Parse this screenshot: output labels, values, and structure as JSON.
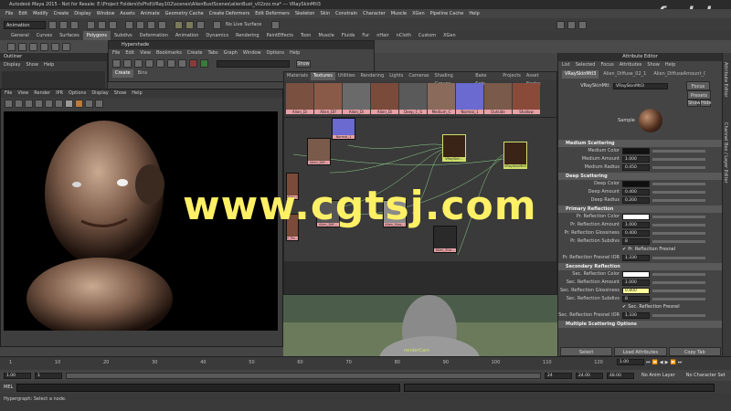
{
  "window": {
    "title": "Autodesk Maya 2015 - Not for Resale: E:\\Project Folders\\fxPhd\\VRay102\\scenes\\AlienBustScenes\\alienBust_v02zzz.ma* --- VRaySkinMtl3"
  },
  "menubar": [
    "File",
    "Edit",
    "Modify",
    "Create",
    "Display",
    "Window",
    "Assets",
    "Animate",
    "Geometry Cache",
    "Create Deformers",
    "Edit Deformers",
    "Skeleton",
    "Skin",
    "Constrain",
    "Character",
    "Muscle",
    "XGen",
    "Pipeline Cache",
    "Help"
  ],
  "statusline": {
    "mode": "Animation",
    "live_surface": "No Live Surface"
  },
  "shelf_tabs": [
    "General",
    "Curves",
    "Surfaces",
    "Polygons",
    "Subdivs",
    "Deformation",
    "Animation",
    "Dynamics",
    "Rendering",
    "PaintEffects",
    "Toon",
    "Muscle",
    "Fluids",
    "Fur",
    "nHair",
    "nCloth",
    "Custom",
    "XGen"
  ],
  "shelf_active": "Polygons",
  "outliner": {
    "title": "Outliner",
    "menu": [
      "Display",
      "Show",
      "Help"
    ]
  },
  "hypershade": {
    "title": "Hypershade",
    "menu": [
      "File",
      "Edit",
      "View",
      "Bookmarks",
      "Create",
      "Tabs",
      "Graph",
      "Window",
      "Options",
      "Help"
    ],
    "left_tabs": [
      "Create",
      "Bins"
    ],
    "show_button": "Show",
    "tabs": [
      "Materials",
      "Textures",
      "Utilities",
      "Rendering",
      "Lights",
      "Cameras",
      "Shading Groups",
      "Bake Sets",
      "Projects",
      "Asset Nodes"
    ],
    "active_tab": "Textures",
    "swatches": [
      "Alien_Di",
      "Alien_Dif",
      "Alien_Di",
      "Alien_Di",
      "Deep_C_S",
      "Medium_C",
      "Normal_1",
      "Outside",
      "Shallow"
    ],
    "nodes": [
      "Normal_1",
      "Alien_Diff...",
      "VRaySkin...",
      "Alien_Diff...",
      "Alien_Glos...",
      "Alien_Glos...",
      "VRaySkinMtl3",
      "C_Ro...",
      "Alien_Sha..."
    ],
    "camera_label": "renderCam"
  },
  "render_view": {
    "menu": [
      "File",
      "View",
      "Render",
      "IPR",
      "Options",
      "Display",
      "Show",
      "Help"
    ]
  },
  "attribute_editor": {
    "title": "Attribute Editor",
    "menu": [
      "List",
      "Selected",
      "Focus",
      "Attributes",
      "Show",
      "Help"
    ],
    "tabs": [
      "VRaySkinMtl3",
      "Alien_Diffuse_02_1",
      "Alien_DiffuseAmount_03_1"
    ],
    "node_label": "VRaySkinMtl:",
    "node_name": "VRaySkinMtl3",
    "buttons": {
      "focus": "Focus",
      "presets": "Presets",
      "show": "Show",
      "hide": "Hide"
    },
    "sample_label": "Sample",
    "sections": [
      {
        "name": "Medium Scattering",
        "rows": [
          {
            "label": "Medium Color",
            "type": "color",
            "color": "#111111"
          },
          {
            "label": "Medium Amount",
            "type": "value",
            "value": "1.000"
          },
          {
            "label": "Medium Radius",
            "type": "value",
            "value": "0.450"
          }
        ]
      },
      {
        "name": "Deep Scattering",
        "rows": [
          {
            "label": "Deep Color",
            "type": "color",
            "color": "#0f0f0f"
          },
          {
            "label": "Deep Amount",
            "type": "value",
            "value": "0.400"
          },
          {
            "label": "Deep Radius",
            "type": "value",
            "value": "0.200"
          }
        ]
      },
      {
        "name": "Primary Reflection",
        "rows": [
          {
            "label": "Pr. Reflection Color",
            "type": "color",
            "color": "#ffffff"
          },
          {
            "label": "Pr. Reflection Amount",
            "type": "value",
            "value": "1.000"
          },
          {
            "label": "Pr. Reflection Glossiness",
            "type": "value",
            "value": "0.400"
          },
          {
            "label": "Pr. Reflection Subdivs",
            "type": "value",
            "value": "8"
          },
          {
            "label": "",
            "type": "check",
            "value": "Pr. Reflection Fresnel"
          },
          {
            "label": "Pr. Reflection Fresnel IOR",
            "type": "value",
            "value": "1.330"
          }
        ]
      },
      {
        "name": "Secondary Reflection",
        "rows": [
          {
            "label": "Sec. Reflection Color",
            "type": "color",
            "color": "#ffffff"
          },
          {
            "label": "Sec. Reflection Amount",
            "type": "value",
            "value": "1.000"
          },
          {
            "label": "Sec. Reflection Glossiness",
            "type": "value",
            "value": "0.800",
            "highlight": "#ffff99"
          },
          {
            "label": "Sec. Reflection Subdivs",
            "type": "value",
            "value": "8"
          },
          {
            "label": "",
            "type": "check",
            "value": "Sec. Reflection Fresnel"
          },
          {
            "label": "Sec. Reflection Fresnel IOR",
            "type": "value",
            "value": "1.330"
          }
        ]
      },
      {
        "name": "Multiple Scattering Options",
        "rows": []
      }
    ],
    "bottom_buttons": [
      "Select",
      "Load Attributes",
      "Copy Tab"
    ],
    "side_tabs": [
      "Attribute Editor",
      "Channel Box / Layer Editor"
    ]
  },
  "timeline": {
    "ticks": [
      "1",
      "10",
      "20",
      "30",
      "40",
      "50",
      "60",
      "70",
      "80",
      "90",
      "100",
      "110",
      "120"
    ],
    "current_frame": "1.00",
    "range_start": "1.00",
    "range_inner_start": "1",
    "range_inner_end": "24",
    "range_end": "24.00",
    "range_max": "48.00",
    "anim_layer": "No Anim Layer",
    "char_set": "No Character Set"
  },
  "cmdline": {
    "lang": "MEL"
  },
  "helpline": "Hypergraph: Select a node.",
  "watermark": "www.cgtsj.com",
  "logo": "fxphd",
  "colors": {
    "accent": "#5a5a5a",
    "swatch_label": "#e7a0a5",
    "node_label": "#e7a0a5",
    "watermark": "#fff066"
  }
}
